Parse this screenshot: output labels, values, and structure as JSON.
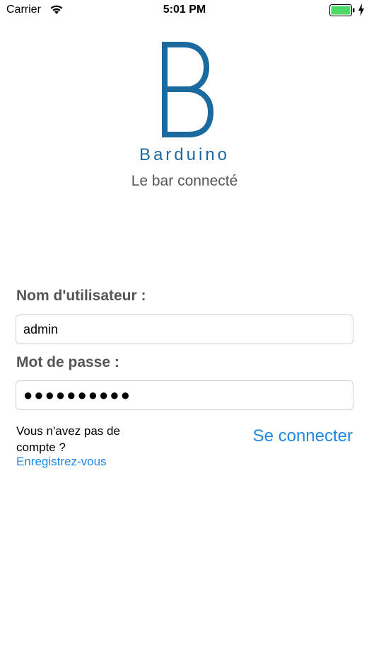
{
  "status_bar": {
    "carrier": "Carrier",
    "time": "5:01 PM",
    "battery_color": "#4cd964"
  },
  "branding": {
    "logo_letter": "B",
    "logo_color": "#1a6aa0",
    "app_name": "Barduino",
    "tagline": "Le bar connecté"
  },
  "login_form": {
    "username_label": "Nom d'utilisateur :",
    "username_value": "admin",
    "password_label": "Mot de passe :",
    "password_value": "●●●●●●●●●●"
  },
  "footer": {
    "no_account_text": "Vous n'avez pas de compte ?",
    "register_link": "Enregistrez-vous",
    "connect_button": "Se connecter",
    "link_color": "#1e88e5"
  }
}
